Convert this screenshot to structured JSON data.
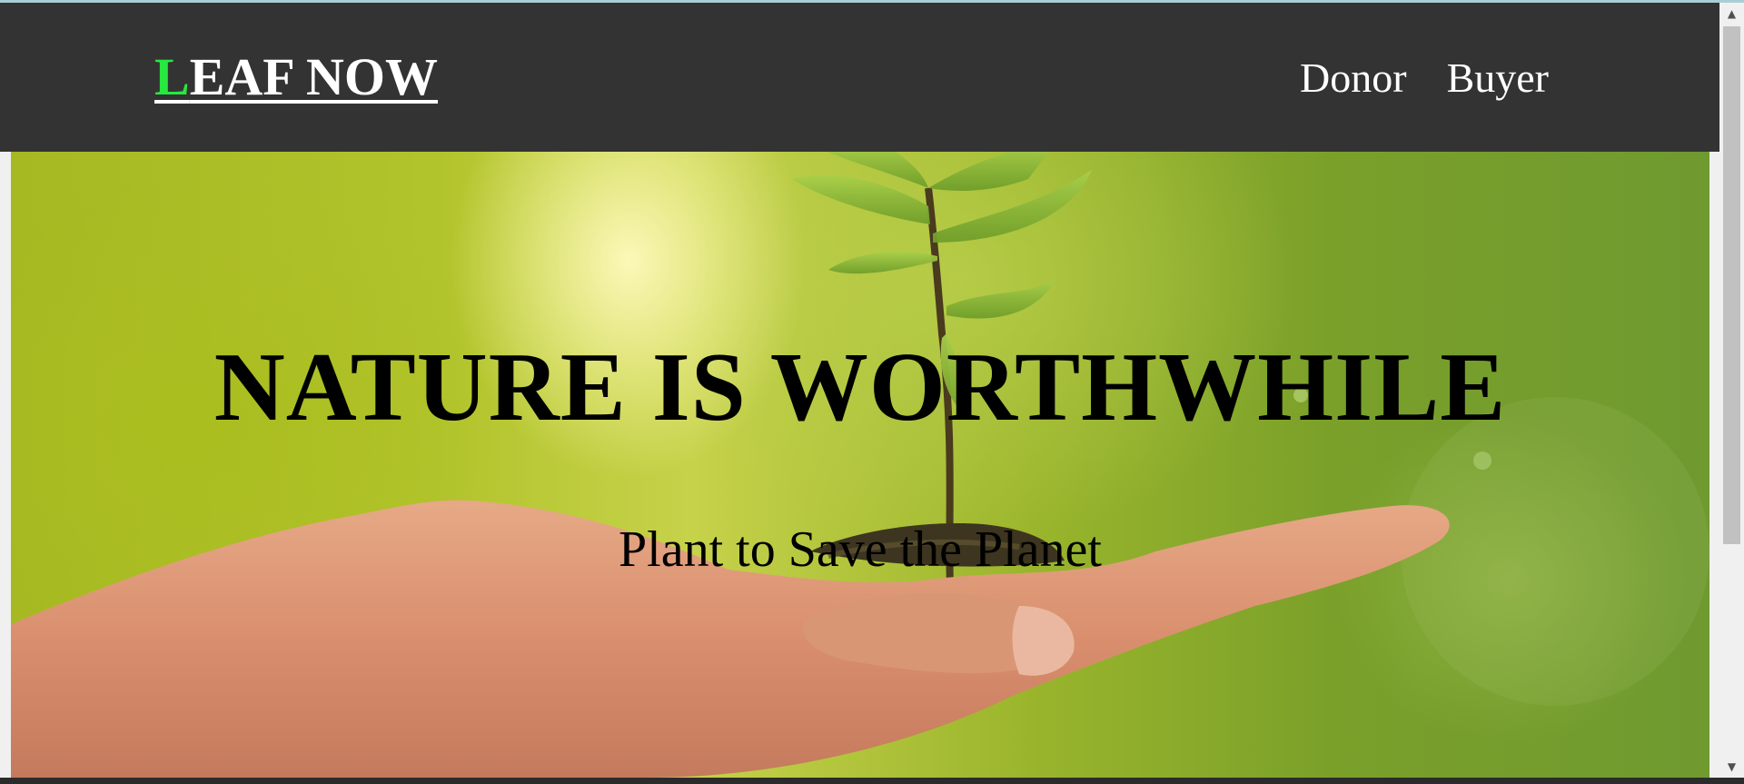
{
  "header": {
    "logo_first_letter": "L",
    "logo_rest": "EAF NOW",
    "nav": [
      {
        "label": "Donor"
      },
      {
        "label": "Buyer"
      }
    ]
  },
  "hero": {
    "title": "NATURE IS WORTHWHILE",
    "subtitle": "Plant to Save the Planet",
    "image_subject": "hand holding seedling in soil"
  },
  "colors": {
    "navbar_bg": "#333333",
    "logo_accent": "#27e83f",
    "text_light": "#ffffff",
    "hero_text": "#000000"
  },
  "icons": [
    "scroll-up-arrow-icon",
    "scroll-down-arrow-icon"
  ]
}
